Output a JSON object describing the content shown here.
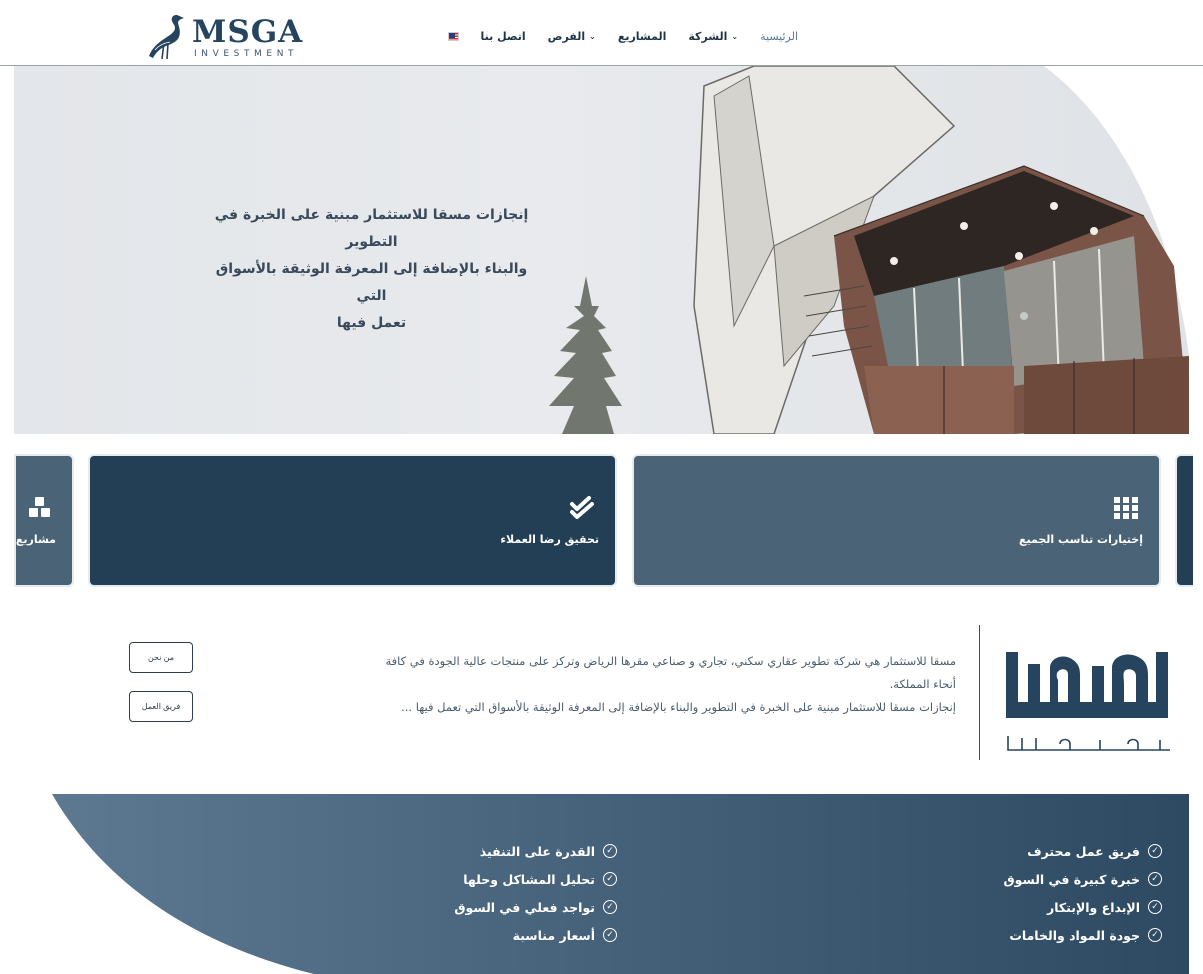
{
  "header": {
    "logo_title": "MSGA",
    "logo_sub": "INVESTMENT",
    "nav": [
      {
        "label": "الرئيسية",
        "active": true,
        "dropdown": false
      },
      {
        "label": "الشركة",
        "active": false,
        "dropdown": true
      },
      {
        "label": "المشاريع",
        "active": false,
        "dropdown": false
      },
      {
        "label": "الفرص",
        "active": false,
        "dropdown": true
      },
      {
        "label": "اتصل بنا",
        "active": false,
        "dropdown": false
      }
    ],
    "language_icon": "us-flag-icon"
  },
  "hero": {
    "text_lines": [
      "إنجازات مسقا للاستثمار مبنية على الخبرة في التطوير",
      "والبناء بالإضافة إلى المعرفة الوثيقة بالأسواق التي",
      "تعمل فيها"
    ]
  },
  "cards": {
    "projects": {
      "title": "مشاريع",
      "icon": "cubes-icon"
    },
    "satisfaction": {
      "title": "تحقيق رضا العملاء",
      "icon": "double-check-icon"
    },
    "choices": {
      "title": "إختيارات تناسب الجميع",
      "icon": "grid-icon"
    }
  },
  "about": {
    "logo_main": "ملسقا",
    "logo_sub": "للاستثمار",
    "lines": [
      "مسقا للاستثمار هي شركة تطوير عقاري سكني، تجاري و صناعي مقرها الرياض وتركز على منتجات عالية الجودة في كافة",
      "أنحاء المملكة.",
      "إنجازات مسقا للاستثمار مبنية على الخبرة في التطوير والبناء بالإضافة إلى المعرفة الوثيقة بالأسواق التي تعمل فيها ..."
    ],
    "btn_about": "من نحن",
    "btn_team": "فريق العمل"
  },
  "features": {
    "right": [
      "فريق عمل محترف",
      "خبرة كبيرة في السوق",
      "الإبداع والإبتكار",
      "جودة المواد والخامات"
    ],
    "left": [
      "القدرة على التنفيذ",
      "تحليل المشاكل وحلها",
      "تواجد فعلي في السوق",
      "أسعار مناسبة"
    ],
    "check_icon": "check-circle-icon"
  },
  "colors": {
    "navy": "#233f56",
    "slate": "#4a6376",
    "accent_text": "#5b7892"
  }
}
